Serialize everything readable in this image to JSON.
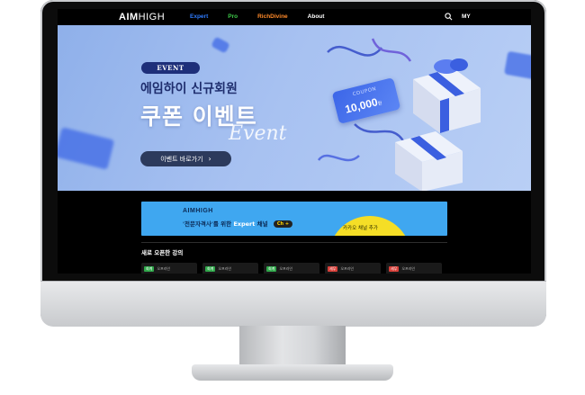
{
  "nav": {
    "logo_bold": "AIM",
    "logo_light": "HIGH",
    "links": [
      {
        "label": "Expert",
        "color": "#2f7cff"
      },
      {
        "label": "Pro",
        "color": "#3ecb4a"
      },
      {
        "label": "RichDivine",
        "color": "#ff8a2a"
      },
      {
        "label": "About",
        "color": "#ffffff"
      }
    ],
    "search_icon": "search-icon",
    "my_label": "MY"
  },
  "hero": {
    "badge": "EVENT",
    "subtitle": "에임하이 신규회원",
    "title": "쿠폰 이벤트",
    "script_text": "Event",
    "cta_label": "이벤트 바로가기",
    "cta_icon": "chevron-right-icon",
    "coupon_label": "COUPON",
    "coupon_value": "10,000",
    "coupon_unit": "원"
  },
  "banner": {
    "logo": "AIMHIGH",
    "text_prefix": "'전문자격사'를 위한",
    "text_highlight": "Expert",
    "text_suffix": "채널",
    "channel_pill": "Ch +",
    "cta_label": "카카오 채널 추가"
  },
  "courses": {
    "section_title": "새로 오픈한 강의",
    "cards": [
      {
        "badge": "회계",
        "badge_color": "#2fa84a",
        "label": "오프라인"
      },
      {
        "badge": "회계",
        "badge_color": "#2fa84a",
        "label": "오프라인"
      },
      {
        "badge": "회계",
        "badge_color": "#2fa84a",
        "label": "오프라인"
      },
      {
        "badge": "세무",
        "badge_color": "#d8403a",
        "label": "오프라인"
      },
      {
        "badge": "세무",
        "badge_color": "#d8403a",
        "label": "오프라인"
      }
    ]
  }
}
